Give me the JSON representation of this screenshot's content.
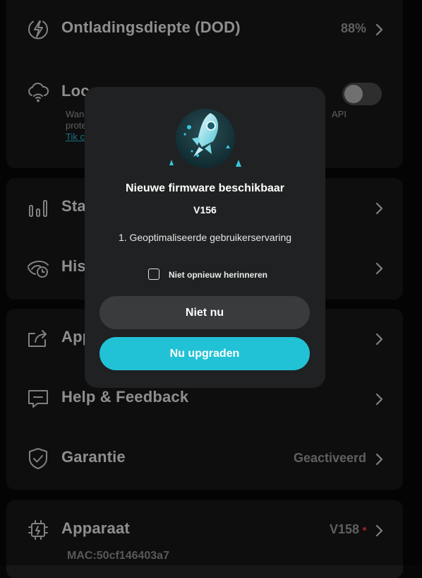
{
  "card1": {
    "dod": {
      "label": "Ontladingsdiepte (DOD)",
      "value": "88%",
      "icon": "lightning-icon"
    },
    "local": {
      "label": "Loc",
      "desc_line1": "Wan",
      "desc_line1_end": "API",
      "desc_line2": "prote",
      "link": "Tik c",
      "icon": "cloud-wifi-icon",
      "toggle_on": false
    }
  },
  "card2": {
    "stats": {
      "label": "Sta",
      "icon": "bar-chart-icon"
    },
    "history": {
      "label": "His",
      "icon": "history-eye-icon"
    }
  },
  "card3": {
    "share": {
      "label": "App",
      "icon": "share-icon"
    },
    "help": {
      "label": "Help & Feedback",
      "icon": "chat-icon"
    },
    "warranty": {
      "label": "Garantie",
      "value": "Geactiveerd",
      "icon": "shield-check-icon"
    }
  },
  "card4": {
    "device": {
      "label": "Apparaat",
      "value": "V158",
      "mac": "MAC:50cf146403a7",
      "icon": "chip-icon",
      "update_dot": true
    }
  },
  "dialog": {
    "title": "Nieuwe firmware beschikbaar",
    "version": "V156",
    "notes": "1. Geoptimaliseerde gebruikerservaring",
    "checkbox_label": "Niet opnieuw herinneren",
    "checkbox_checked": false,
    "later_button": "Niet nu",
    "upgrade_button": "Nu upgraden",
    "illustration": "rocket-icon"
  },
  "colors": {
    "background": "#070707",
    "card": "#171717",
    "dialog": "#202122",
    "accent": "#22c2d6",
    "link": "#25b9cf",
    "status_dot": "#d93a3a"
  }
}
